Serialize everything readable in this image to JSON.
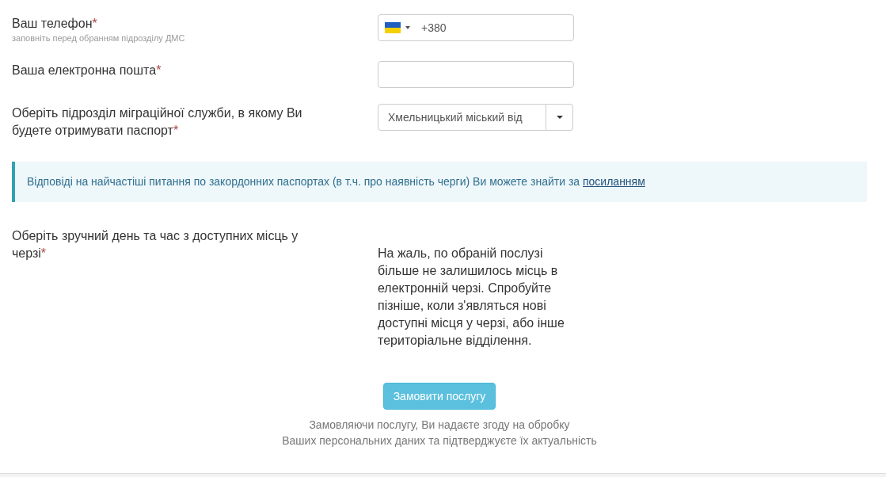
{
  "fields": [
    {
      "kind": "phone",
      "label": "Ваш телефон",
      "required": "*",
      "hint": "заповніть перед обранням підрозділу ДМС",
      "value": "+380"
    },
    {
      "kind": "text",
      "label": "Ваша електронна пошта",
      "required": "*"
    },
    {
      "kind": "select",
      "label": "Оберіть підрозділ міграційної служби, в якому Ви будете отримувати паспорт",
      "required": "*",
      "value": "Хмельницький міський від"
    }
  ],
  "alert": {
    "text": "Відповіді на найчастіші питання по закордонних паспортах (в т.ч. про наявність черги) Ви можете знайти за",
    "link": "посиланням"
  },
  "schedule": {
    "label": "Оберіть зручний день та час з доступних місць у черзі",
    "required": "*",
    "message": "На жаль, по обраній послузі більше не залишилось місць в електронній черзі. Спробуйте пізніше, коли з'являться нові доступні місця у черзі, або інше територіальне відділення."
  },
  "submit": "Замовити послугу",
  "consent": [
    "Замовляючи послугу, Ви надаєте згоду на обробку",
    "Ваших персональних даних та підтверджуєте їх актуальність"
  ]
}
